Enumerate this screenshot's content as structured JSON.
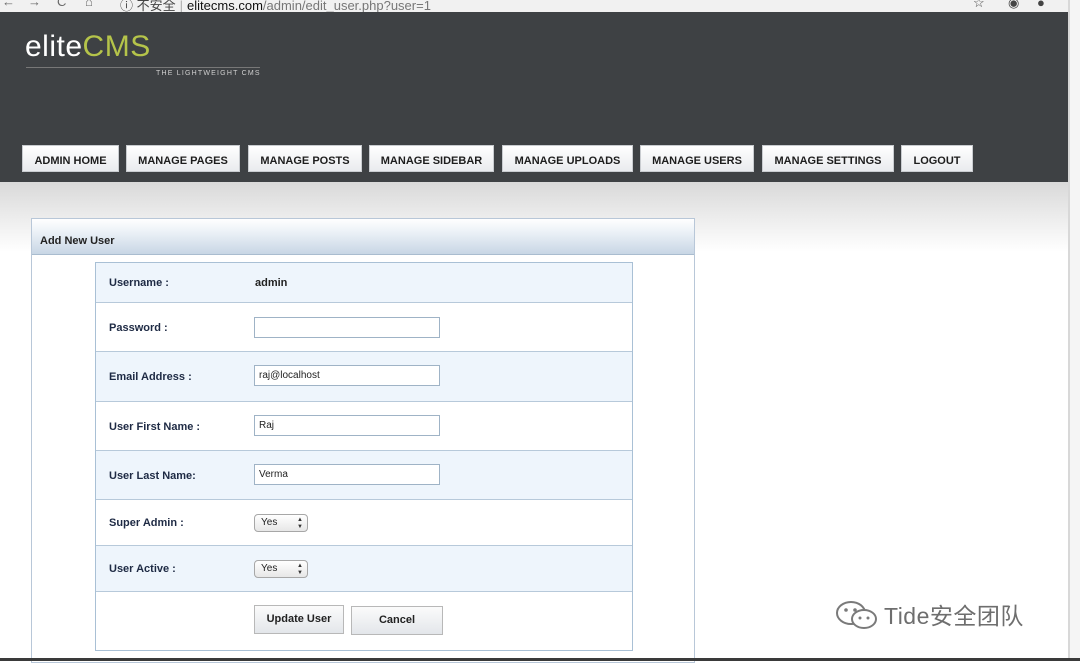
{
  "browser": {
    "nav_glyphs": [
      "←",
      "→",
      "C",
      "⌂"
    ],
    "insecure_label": "不安全",
    "url_host": "elitecms.com",
    "url_path": "/admin/edit_user.php?user=1"
  },
  "site": {
    "logo_part1": "elite",
    "logo_part2": "CMS",
    "tagline": "THE LIGHTWEIGHT CMS",
    "colors": {
      "header": "#3e4144",
      "logo_accent": "#b5c44a"
    }
  },
  "menu": [
    "ADMIN HOME",
    "MANAGE PAGES",
    "MANAGE POSTS",
    "MANAGE SIDEBAR",
    "MANAGE UPLOADS",
    "MANAGE USERS",
    "MANAGE SETTINGS",
    "LOGOUT"
  ],
  "panel": {
    "title": "Add New User"
  },
  "form": {
    "username": {
      "label": "Username :",
      "value": "admin"
    },
    "password": {
      "label": "Password :",
      "value": ""
    },
    "email": {
      "label": "Email Address :",
      "value": "raj@localhost"
    },
    "first_name": {
      "label": "User First Name :",
      "value": "Raj"
    },
    "last_name": {
      "label": "User Last Name:",
      "value": "Verma"
    },
    "super_admin": {
      "label": "Super Admin :",
      "selected": "Yes"
    },
    "user_active": {
      "label": "User Active :",
      "selected": "Yes"
    },
    "submit_label": "Update User",
    "cancel_label": "Cancel"
  },
  "watermark": {
    "text": "Tide安全团队"
  }
}
